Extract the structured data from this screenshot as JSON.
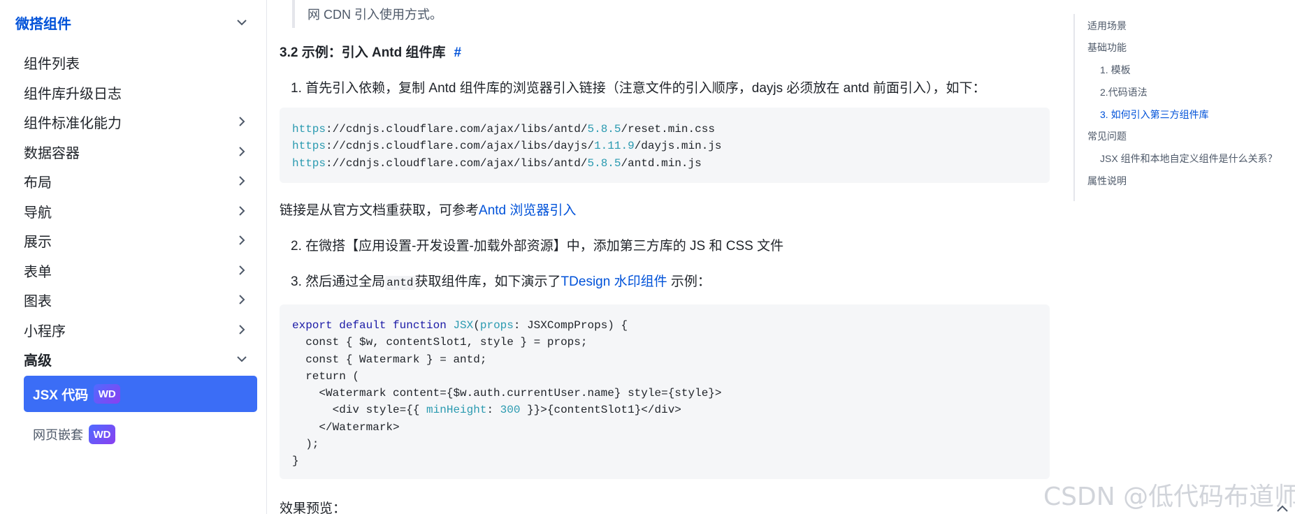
{
  "sidebar": {
    "section_top": "微搭组件",
    "items": [
      {
        "label": "组件列表"
      },
      {
        "label": "组件库升级日志"
      },
      {
        "label": "组件标准化能力"
      },
      {
        "label": "数据容器"
      },
      {
        "label": "布局"
      },
      {
        "label": "导航"
      },
      {
        "label": "展示"
      },
      {
        "label": "表单"
      },
      {
        "label": "图表"
      },
      {
        "label": "小程序"
      }
    ],
    "section_advanced": "高级",
    "active_item": {
      "label": "JSX 代码",
      "badge": "WD"
    },
    "sub_item": {
      "label": "网页嵌套",
      "badge": "WD"
    }
  },
  "main": {
    "top_note_line2": "网 CDN 引入使用方式。",
    "section_heading": "3.2 示例：引入 Antd 组件库",
    "heading_anchor": "#",
    "step1": "1. 首先引入依赖，复制 Antd 组件库的浏览器引入链接（注意文件的引入顺序，dayjs 必须放在 antd 前面引入），如下：",
    "code1": [
      {
        "proto": "https",
        "path1": "://cdnjs.cloudflare.com/ajax/libs/antd/",
        "ver": "5.8.5",
        "path2": "/reset.min.css"
      },
      {
        "proto": "https",
        "path1": "://cdnjs.cloudflare.com/ajax/libs/dayjs/",
        "ver": "1.11.9",
        "path2": "/dayjs.min.js"
      },
      {
        "proto": "https",
        "path1": "://cdnjs.cloudflare.com/ajax/libs/antd/",
        "ver": "5.8.5",
        "path2": "/antd.min.js"
      }
    ],
    "source_text": "链接是从官方文档重获取，可参考",
    "source_link": "Antd 浏览器引入",
    "step2": "2. 在微搭【应用设置-开发设置-加载外部资源】中，添加第三方库的 JS 和 CSS 文件",
    "step3_a": "3. 然后通过全局",
    "step3_code": "antd",
    "step3_b": "获取组件库，如下演示了",
    "step3_link": "TDesign 水印组件",
    "step3_c": " 示例：",
    "code2": {
      "l1_kw": "export default function ",
      "l1_fn": "JSX",
      "l1_open": "(",
      "l1_param": "props",
      "l1_rest": ": JSXCompProps) {",
      "l2": "  const { $w, contentSlot1, style } = props;",
      "l3": "  const { Watermark } = antd;",
      "l4": "  return (",
      "l5": "    <Watermark content={$w.auth.currentUser.name} style={style}>",
      "l6_a": "      <div style={{ ",
      "l6_key": "minHeight",
      "l6_colon": ": ",
      "l6_num": "300",
      "l6_b": " }}>{contentSlot1}</div>",
      "l7": "    </Watermark>",
      "l8": "  );",
      "l9": "}"
    },
    "preview_label": "效果预览："
  },
  "toc": {
    "items": [
      {
        "label": "适用场景"
      },
      {
        "label": "基础功能"
      },
      {
        "label": "1. 模板"
      },
      {
        "label": "2.代码语法"
      },
      {
        "label": "3. 如何引入第三方组件库"
      },
      {
        "label": "常见问题"
      },
      {
        "label": "JSX 组件和本地自定义组件是什么关系？"
      },
      {
        "label": "属性说明"
      }
    ]
  },
  "watermark": "CSDN @低代码布道师",
  "colors": {
    "accent": "#0052d9",
    "active_bg": "#3b6df6",
    "code_bg": "#f5f6f8"
  }
}
